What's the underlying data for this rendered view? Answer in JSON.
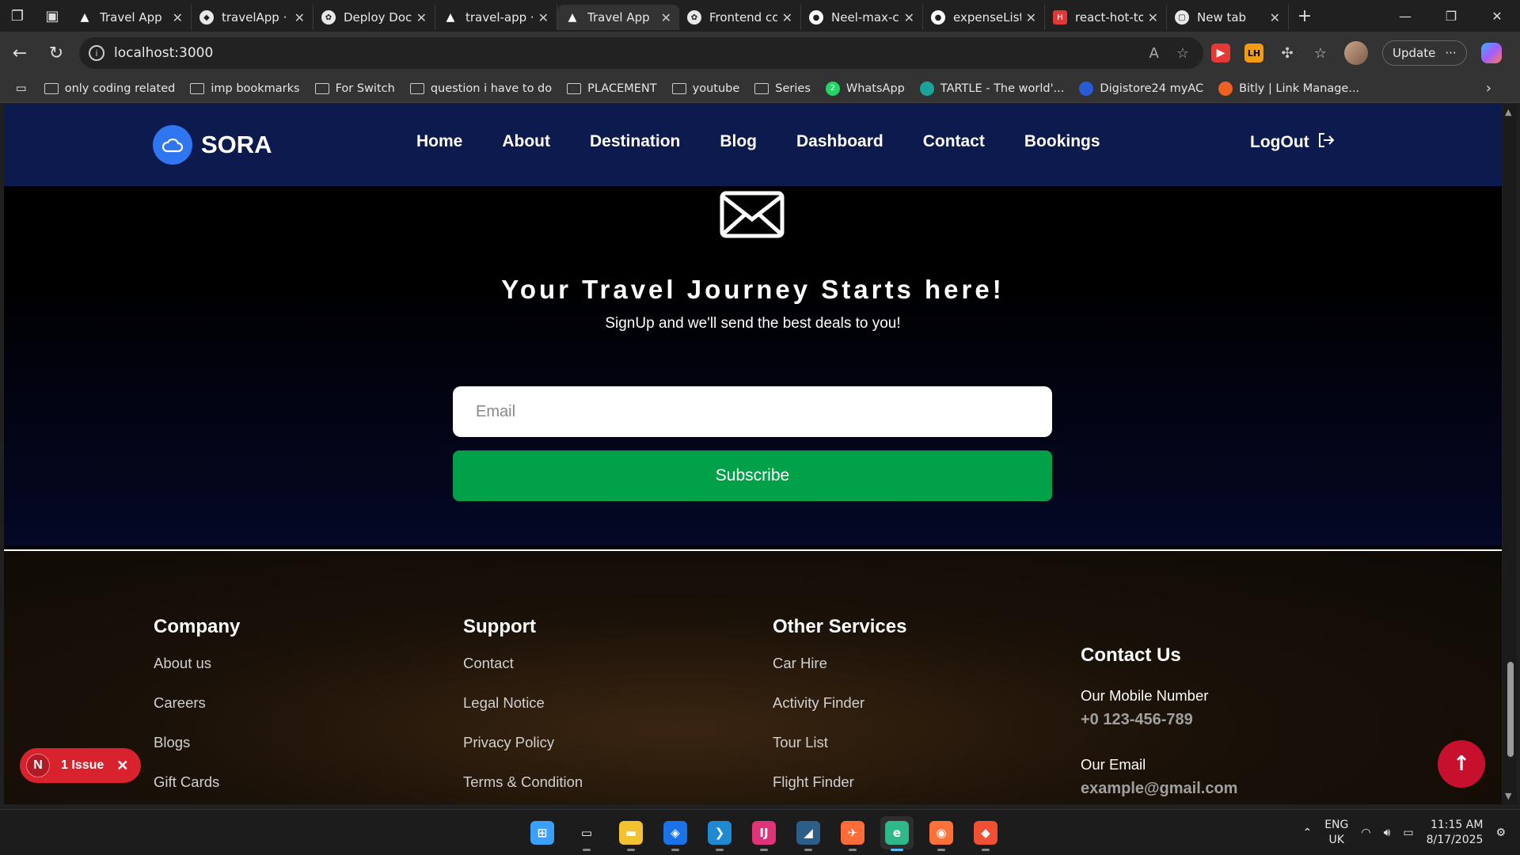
{
  "browser": {
    "tabs": [
      {
        "title": "Travel App",
        "icon": "vercel-triangle-icon",
        "active": false
      },
      {
        "title": "travelApp ·",
        "icon": "render-icon",
        "active": false
      },
      {
        "title": "Deploy Doc",
        "icon": "chatgpt-icon",
        "active": false
      },
      {
        "title": "travel-app ·",
        "icon": "vercel-triangle-icon",
        "active": false
      },
      {
        "title": "Travel App",
        "icon": "vercel-triangle-icon",
        "active": true
      },
      {
        "title": "Frontend cc",
        "icon": "chatgpt-icon",
        "active": false
      },
      {
        "title": "Neel-max-c",
        "icon": "github-icon",
        "active": false
      },
      {
        "title": "expenseList",
        "icon": "github-icon",
        "active": false
      },
      {
        "title": "react-hot-to",
        "icon": "react-hot-toast-icon",
        "active": false
      },
      {
        "title": "New tab",
        "icon": "newtab-icon",
        "active": false
      }
    ],
    "url": "localhost:3000",
    "update_label": "Update",
    "bookmarks": [
      {
        "label": "only coding  related",
        "icon": "folder-icon"
      },
      {
        "label": "imp bookmarks",
        "icon": "folder-icon"
      },
      {
        "label": "For Switch",
        "icon": "folder-icon"
      },
      {
        "label": "question i have to do",
        "icon": "folder-icon"
      },
      {
        "label": "PLACEMENT",
        "icon": "folder-icon"
      },
      {
        "label": "youtube",
        "icon": "folder-icon"
      },
      {
        "label": "Series",
        "icon": "folder-icon"
      },
      {
        "label": "WhatsApp",
        "icon": "whatsapp-icon"
      },
      {
        "label": "TARTLE - The world'...",
        "icon": "tartle-icon"
      },
      {
        "label": "Digistore24 myAC",
        "icon": "digistore-icon"
      },
      {
        "label": "Bitly | Link Manage...",
        "icon": "bitly-icon"
      }
    ],
    "whatsapp_badge": "2"
  },
  "site": {
    "brand": "SORA",
    "nav": [
      "Home",
      "About",
      "Destination",
      "Blog",
      "Dashboard",
      "Contact",
      "Bookings"
    ],
    "logout_label": "LogOut"
  },
  "newsletter": {
    "title": "Your Travel Journey Starts here!",
    "subtitle": "SignUp and we'll send the best deals to you!",
    "email_placeholder": "Email",
    "email_value": "",
    "subscribe_label": "Subscribe"
  },
  "footer": {
    "company": {
      "heading": "Company",
      "links": [
        "About us",
        "Careers",
        "Blogs",
        "Gift Cards"
      ]
    },
    "support": {
      "heading": "Support",
      "links": [
        "Contact",
        "Legal Notice",
        "Privacy Policy",
        "Terms & Condition"
      ]
    },
    "services": {
      "heading": "Other Services",
      "links": [
        "Car Hire",
        "Activity Finder",
        "Tour List",
        "Flight Finder"
      ]
    },
    "contact": {
      "heading": "Contact Us",
      "mobile_label": "Our Mobile Number",
      "mobile_value": "+0 123-456-789",
      "email_label": "Our Email",
      "email_value": "example@gmail.com"
    }
  },
  "overlay": {
    "issue_letter": "N",
    "issue_label": "1 Issue"
  },
  "taskbar": {
    "apps": [
      "windows-start-icon",
      "task-manager-icon",
      "file-explorer-icon",
      "azure-data-studio-icon",
      "vscode-icon",
      "intellij-icon",
      "mysql-workbench-icon",
      "postman-icon",
      "edge-icon",
      "firefox-icon",
      "git-icon"
    ],
    "lang_line1": "ENG",
    "lang_line2": "UK",
    "time": "11:15 AM",
    "date": "8/17/2025"
  },
  "colors": {
    "nav_bg": "#0d1a4d",
    "brand_blue": "#2f76f0",
    "subscribe_green": "#00a148",
    "issue_red": "#d8232f",
    "scrolltop_red": "#c7102e"
  }
}
